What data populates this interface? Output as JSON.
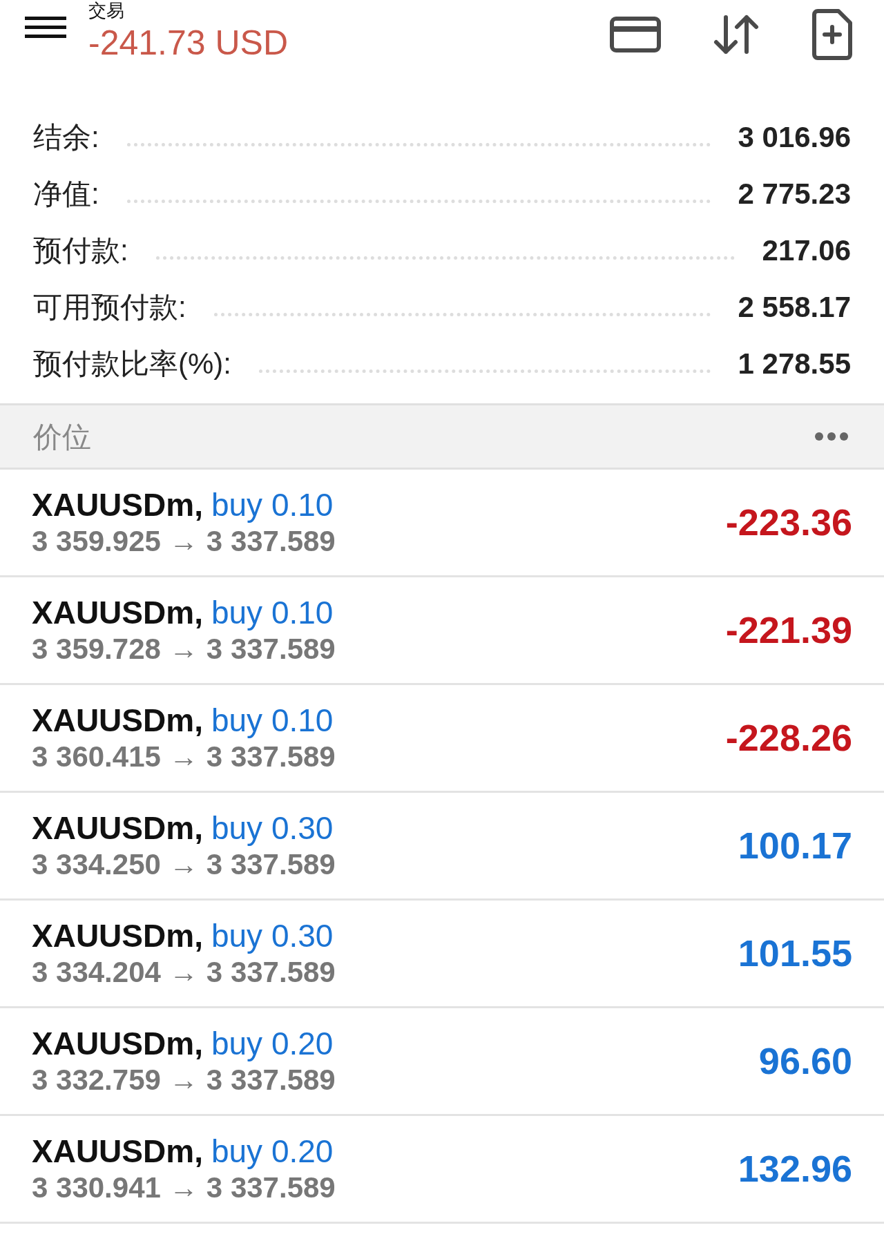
{
  "header": {
    "title": "交易",
    "balance": "-241.73 USD"
  },
  "summary": [
    {
      "label": "结余:",
      "value": "3 016.96"
    },
    {
      "label": "净值:",
      "value": "2 775.23"
    },
    {
      "label": "预付款:",
      "value": "217.06"
    },
    {
      "label": "可用预付款:",
      "value": "2 558.17"
    },
    {
      "label": "预付款比率(%):",
      "value": "1 278.55"
    }
  ],
  "positions_header": {
    "title": "价位"
  },
  "positions": [
    {
      "symbol": "XAUUSDm,",
      "order": "buy 0.10",
      "open": "3 359.925",
      "arrow": "→",
      "current": "3 337.589",
      "profit": "-223.36",
      "kind": "loss"
    },
    {
      "symbol": "XAUUSDm,",
      "order": "buy 0.10",
      "open": "3 359.728",
      "arrow": "→",
      "current": "3 337.589",
      "profit": "-221.39",
      "kind": "loss"
    },
    {
      "symbol": "XAUUSDm,",
      "order": "buy 0.10",
      "open": "3 360.415",
      "arrow": "→",
      "current": "3 337.589",
      "profit": "-228.26",
      "kind": "loss"
    },
    {
      "symbol": "XAUUSDm,",
      "order": "buy 0.30",
      "open": "3 334.250",
      "arrow": "→",
      "current": "3 337.589",
      "profit": "100.17",
      "kind": "gain"
    },
    {
      "symbol": "XAUUSDm,",
      "order": "buy 0.30",
      "open": "3 334.204",
      "arrow": "→",
      "current": "3 337.589",
      "profit": "101.55",
      "kind": "gain"
    },
    {
      "symbol": "XAUUSDm,",
      "order": "buy 0.20",
      "open": "3 332.759",
      "arrow": "→",
      "current": "3 337.589",
      "profit": "96.60",
      "kind": "gain"
    },
    {
      "symbol": "XAUUSDm,",
      "order": "buy 0.20",
      "open": "3 330.941",
      "arrow": "→",
      "current": "3 337.589",
      "profit": "132.96",
      "kind": "gain"
    }
  ]
}
